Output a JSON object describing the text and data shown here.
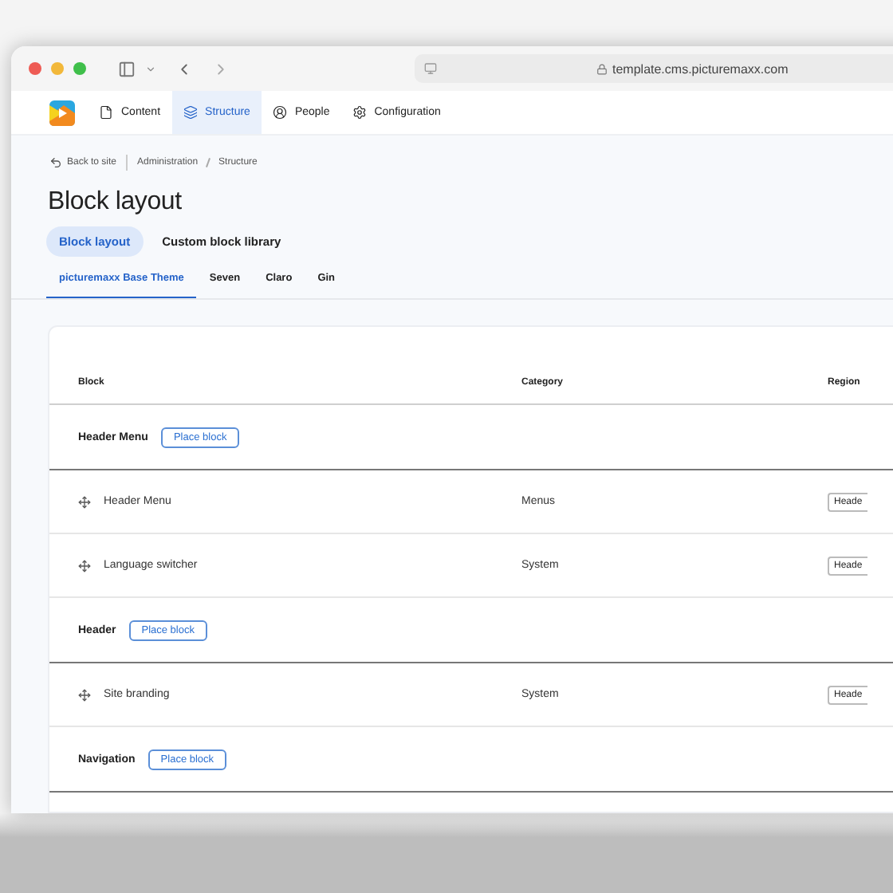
{
  "browser": {
    "url": "template.cms.picturemaxx.com"
  },
  "toolbar": [
    {
      "label": "Content",
      "selected": false
    },
    {
      "label": "Structure",
      "selected": true
    },
    {
      "label": "People",
      "selected": false
    },
    {
      "label": "Configuration",
      "selected": false
    }
  ],
  "breadcrumb": {
    "back": "Back to site",
    "items": [
      "Administration",
      "Structure"
    ]
  },
  "title": "Block layout",
  "tabs": [
    {
      "label": "Block layout",
      "selected": true
    },
    {
      "label": "Custom block library",
      "selected": false
    }
  ],
  "theme_tabs": [
    {
      "label": "picturemaxx Base Theme",
      "selected": true
    },
    {
      "label": "Seven",
      "selected": false
    },
    {
      "label": "Claro",
      "selected": false
    },
    {
      "label": "Gin",
      "selected": false
    }
  ],
  "table": {
    "columns": [
      "Block",
      "Category",
      "Region"
    ],
    "rows": [
      {
        "kind": "region",
        "label": "Header Menu",
        "button": "Place block"
      },
      {
        "kind": "block",
        "block": "Header Menu",
        "category": "Menus",
        "region": "Heade"
      },
      {
        "kind": "block",
        "block": "Language switcher",
        "category": "System",
        "region": "Heade"
      },
      {
        "kind": "region",
        "label": "Header",
        "button": "Place block"
      },
      {
        "kind": "block",
        "block": "Site branding",
        "category": "System",
        "region": "Heade"
      },
      {
        "kind": "region",
        "label": "Navigation",
        "button": "Place block"
      }
    ]
  }
}
